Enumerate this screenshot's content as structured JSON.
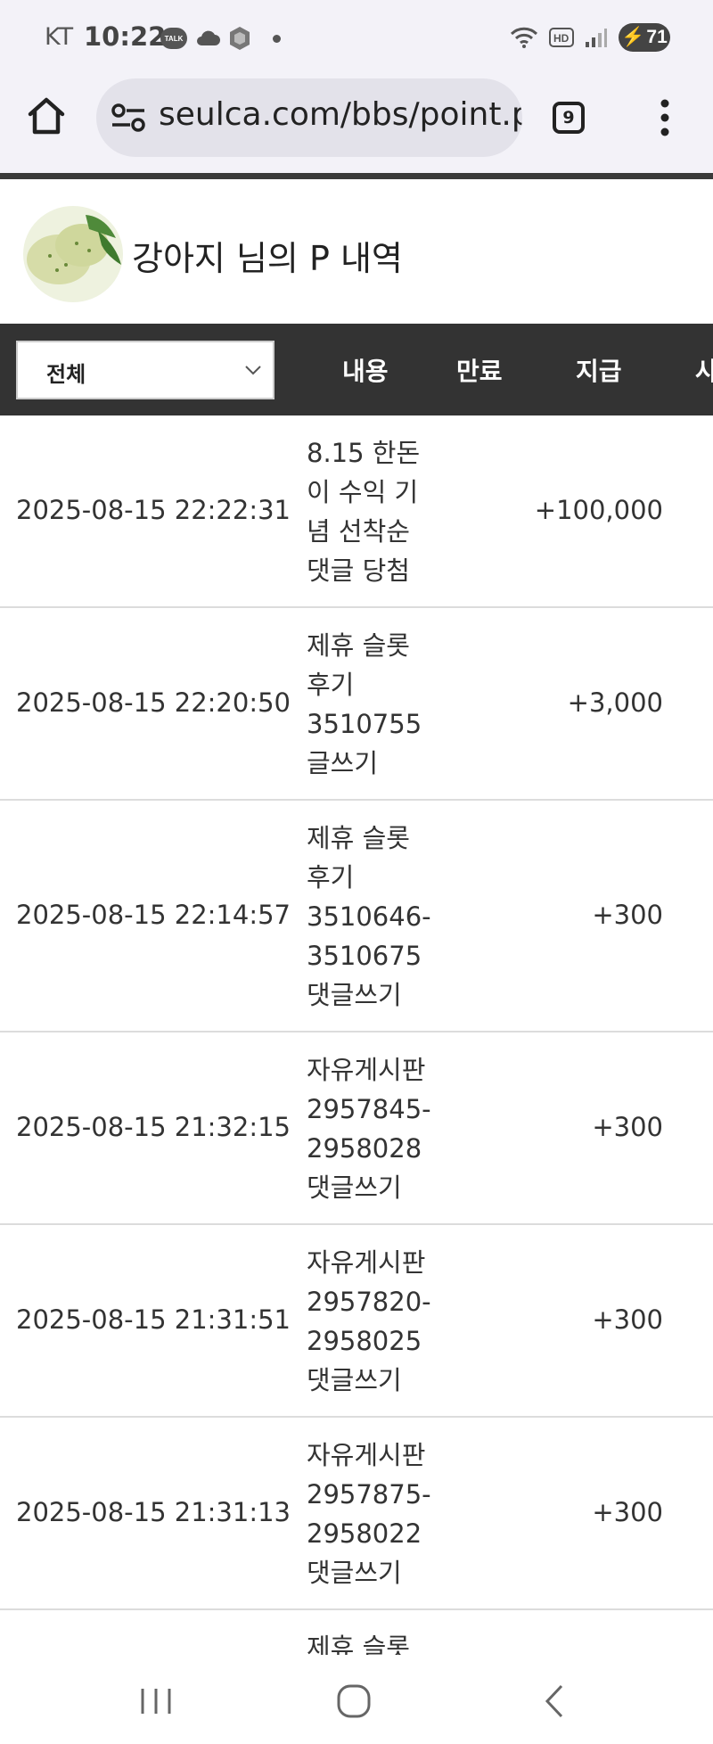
{
  "status_bar": {
    "carrier": "KT",
    "time": "10:22",
    "talk_badge": "TALK",
    "battery": "71"
  },
  "browser": {
    "url": "seulca.com/bbs/point.php",
    "tab_count": "9"
  },
  "header": {
    "title": "강아지 님의 P 내역"
  },
  "filter": {
    "selected": "전체",
    "columns": [
      "내용",
      "만료",
      "지급",
      "사"
    ]
  },
  "rows": [
    {
      "date": "2025-08-15 22:22:31",
      "desc": "8.15 한돈\n이 수익 기\n념 선착순\n댓글 당첨",
      "amount": "+100,000"
    },
    {
      "date": "2025-08-15 22:20:50",
      "desc": "제휴 슬롯\n후기\n3510755\n글쓰기",
      "amount": "+3,000"
    },
    {
      "date": "2025-08-15 22:14:57",
      "desc": "제휴 슬롯\n후기\n3510646-\n3510675\n댓글쓰기",
      "amount": "+300"
    },
    {
      "date": "2025-08-15 21:32:15",
      "desc": "자유게시판\n2957845-\n2958028\n댓글쓰기",
      "amount": "+300"
    },
    {
      "date": "2025-08-15 21:31:51",
      "desc": "자유게시판\n2957820-\n2958025\n댓글쓰기",
      "amount": "+300"
    },
    {
      "date": "2025-08-15 21:31:13",
      "desc": "자유게시판\n2957875-\n2958022\n댓글쓰기",
      "amount": "+300"
    },
    {
      "date": "",
      "desc": "제휴 슬롯",
      "amount": ""
    }
  ],
  "icons": {
    "home": "home-icon",
    "url_settings": "tune-icon",
    "menu": "more-vert-icon",
    "nav_recent": "recent-apps-icon",
    "nav_home": "nav-home-icon",
    "nav_back": "back-icon"
  },
  "colors": {
    "toolbar_bg": "#f3f2f8",
    "filter_bar_bg": "#333333",
    "row_divider": "#dcdcdc"
  }
}
